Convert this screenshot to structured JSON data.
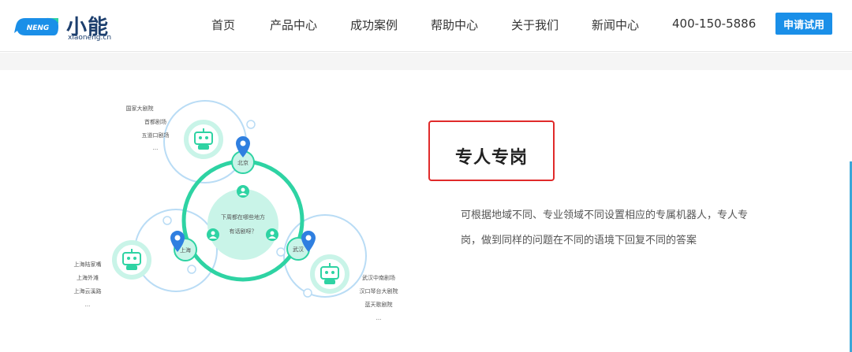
{
  "logo": {
    "bubble_text": "NENG",
    "cn": "小能",
    "en": "xiaoneng.cn"
  },
  "nav": {
    "items": [
      "首页",
      "产品中心",
      "成功案例",
      "帮助中心",
      "关于我们",
      "新闻中心"
    ],
    "phone": "400-150-5886",
    "apply_label": "申请试用"
  },
  "diagram": {
    "center_line1": "下周都在哪些地方",
    "center_line2": "有话剧呀？",
    "cities": {
      "top": "北京",
      "left": "上海",
      "right": "武汉"
    },
    "beijing_list": [
      "国家大剧院",
      "首都剧场",
      "五道口剧场",
      "..."
    ],
    "shanghai_list": [
      "上海陆家嘴",
      "上海外滩",
      "上海云溪路",
      "..."
    ],
    "wuhan_list": [
      "武汉中南剧场",
      "汉口琴台大剧院",
      "蓝天歌剧院",
      "..."
    ],
    "colors": {
      "ring": "#2ed3a3",
      "light_ring": "#b9dcf5",
      "fill": "#c9f4e8",
      "pin": "#2f7fe0"
    }
  },
  "content": {
    "title": "专人专岗",
    "desc_line1": "可根据地域不同、专业领域不同设置相应的专属机器人，专人专",
    "desc_line2": "岗，做到同样的问题在不同的语境下回复不同的答案"
  }
}
